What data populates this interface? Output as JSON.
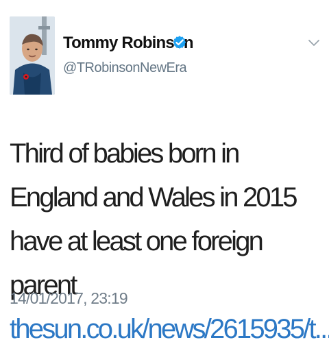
{
  "tweet": {
    "author": {
      "name": "Tommy Robinson",
      "handle": "@TRobinsonNewEra",
      "verified_icon": "verified-badge-icon",
      "avatar_icon": "profile-photo"
    },
    "text": "Third of babies born in England and Wales in 2015 have at least one foreign parent",
    "link_text": "thesun.co.uk/news/2615935/t...",
    "timestamp": "14/01/2017, 23:19",
    "menu_icon": "chevron-down-icon"
  },
  "colors": {
    "background": "#ffffff",
    "text": "#1f1f1f",
    "muted": "#657786",
    "link": "#2c78c5",
    "verified": "#1da1f2"
  }
}
